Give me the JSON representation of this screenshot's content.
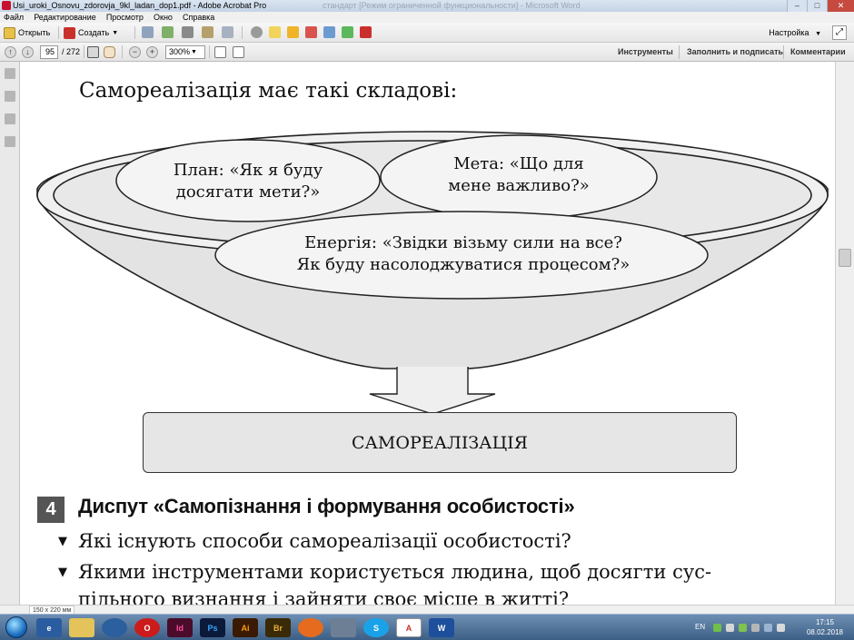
{
  "window": {
    "title": "Usi_uroki_Osnovu_zdorovja_9kl_ladan_dop1.pdf - Adobe Acrobat Pro",
    "faded_title": "стандарт [Режим ограниченной функциональности] - Microsoft Word"
  },
  "menu": [
    "Файл",
    "Редактирование",
    "Просмотр",
    "Окно",
    "Справка"
  ],
  "toolbar": {
    "open_label": "Открыть",
    "create_label": "Создать",
    "settings_label": "Настройка"
  },
  "navbar": {
    "page_current": "95",
    "page_total": "/ 272",
    "zoom": "300%",
    "links": [
      "Инструменты",
      "Заполнить и подписать",
      "Комментарии"
    ]
  },
  "document": {
    "heading": "Самореалізація має такі складові:",
    "ovals": {
      "plan": [
        "План: «Як я буду",
        "досягати мети?»"
      ],
      "goal": [
        "Мета: «Що для",
        "мене важливо?»"
      ],
      "energy": [
        "Енергія: «Звідки візьму сили на все?",
        "Як буду насолоджуватися процесом?»"
      ]
    },
    "result_box": "САМОРЕАЛІЗАЦІЯ",
    "section": {
      "number": "4",
      "title": "Диспут «Самопізнання і формування особистості»",
      "bullet_marker": "▼",
      "q1": "Які існують способи самореалізації особистості?",
      "q2_line1": "Якими інструментами користується людина, щоб досягти сус-",
      "q2_line2": "пільного визнання і зайняти своє місце в житті?"
    }
  },
  "status": {
    "page_size": "150 x 220 мм"
  },
  "taskbar": {
    "apps": [
      "Id",
      "Ps",
      "Ai",
      "Br",
      "W"
    ],
    "language": "EN",
    "time": "17:15",
    "date": "08.02.2018"
  },
  "colors": {
    "bowl_fill": "#e3e3e3",
    "oval_fill": "#f4f4f4",
    "result_fill": "#e6e6e6",
    "section_badge": "#555555",
    "taskbar": "#4a6d94"
  }
}
